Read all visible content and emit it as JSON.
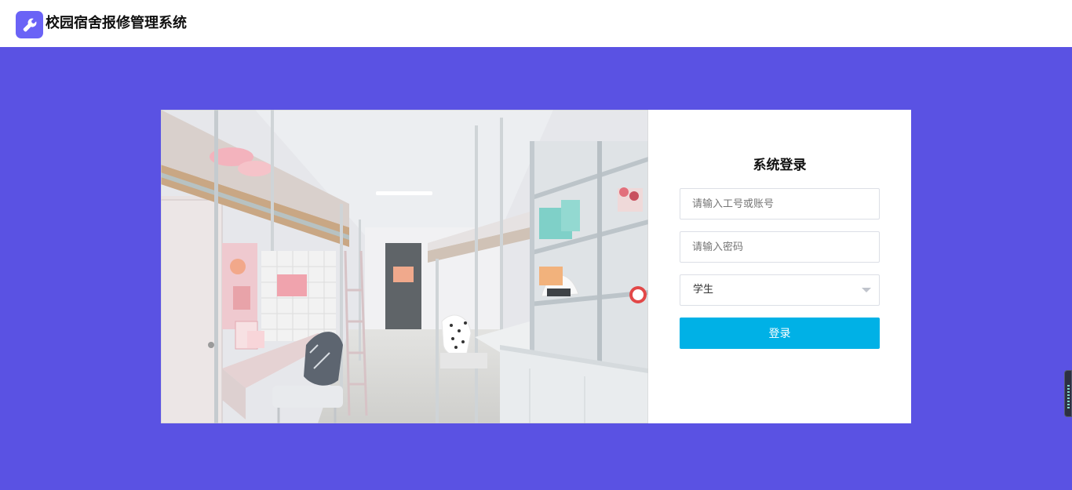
{
  "header": {
    "app_title": "校园宿舍报修管理系统",
    "logo_icon": "wrench-icon",
    "logo_color": "#6a63f6"
  },
  "main": {
    "background_color": "#5a52e3"
  },
  "login": {
    "title": "系统登录",
    "account_placeholder": "请输入工号或账号",
    "password_placeholder": "请输入密码",
    "role_selected": "学生",
    "submit_label": "登录",
    "submit_color": "#00b1e6"
  },
  "side_widget": {
    "icon": "side-toolbar-icon"
  }
}
